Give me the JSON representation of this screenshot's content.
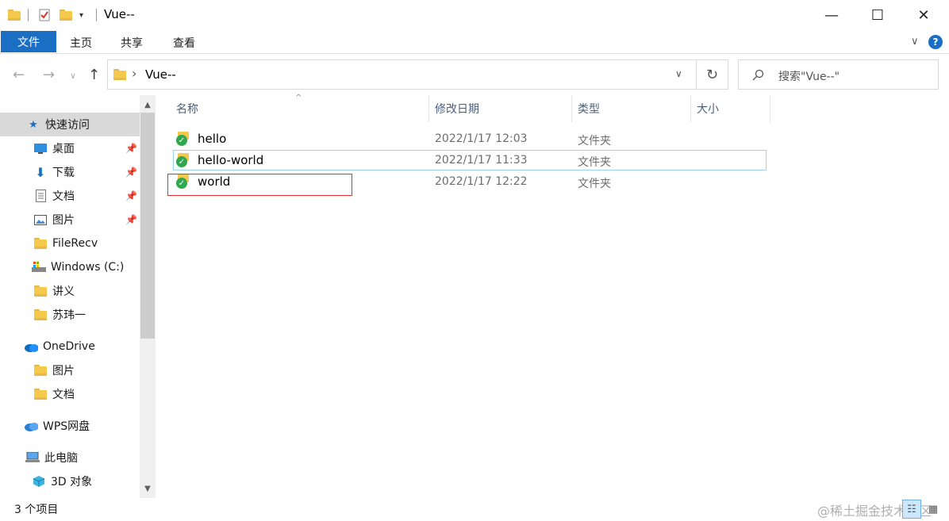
{
  "window": {
    "title": "Vue--",
    "minimize": "—",
    "maximize": "☐",
    "close": "✕"
  },
  "ribbon": {
    "tabs": [
      "文件",
      "主页",
      "共享",
      "查看"
    ],
    "expand": "∨",
    "help": "?"
  },
  "address": {
    "back": "←",
    "forward": "→",
    "recent": "∨",
    "up": "↑",
    "chevron": "›",
    "path": "Vue--",
    "dropdown": "∨",
    "refresh": "↻",
    "search_placeholder": "搜索\"Vue--\""
  },
  "nav": {
    "items": [
      {
        "label": "快速访问",
        "icon": "star-icon"
      },
      {
        "label": "桌面",
        "icon": "desktop-icon"
      },
      {
        "label": "下载",
        "icon": "download-icon"
      },
      {
        "label": "文档",
        "icon": "document-icon"
      },
      {
        "label": "图片",
        "icon": "picture-icon"
      },
      {
        "label": "FileRecv",
        "icon": "folder-icon"
      },
      {
        "label": "Windows (C:)",
        "icon": "drive-icon"
      },
      {
        "label": "讲义",
        "icon": "folder-icon"
      },
      {
        "label": "苏玮一",
        "icon": "folder-icon"
      },
      {
        "label": "OneDrive",
        "icon": "cloud-icon"
      },
      {
        "label": "图片",
        "icon": "folder-icon"
      },
      {
        "label": "文档",
        "icon": "folder-icon"
      },
      {
        "label": "WPS网盘",
        "icon": "cloud-icon"
      },
      {
        "label": "此电脑",
        "icon": "computer-icon"
      },
      {
        "label": "3D 对象",
        "icon": "cube-icon"
      }
    ]
  },
  "columns": {
    "name": "名称",
    "date": "修改日期",
    "type": "类型",
    "size": "大小"
  },
  "files": [
    {
      "name": "hello",
      "date": "2022/1/17 12:03",
      "type": "文件夹"
    },
    {
      "name": "hello-world",
      "date": "2022/1/17 11:33",
      "type": "文件夹"
    },
    {
      "name": "world",
      "date": "2022/1/17 12:22",
      "type": "文件夹"
    }
  ],
  "status": {
    "count": "3 个项目",
    "watermark": "@稀土掘金技术社区"
  },
  "colors": {
    "accent": "#1a6fc4",
    "selection_border": "#99d1ff",
    "highlight_box": "#e0302f"
  }
}
